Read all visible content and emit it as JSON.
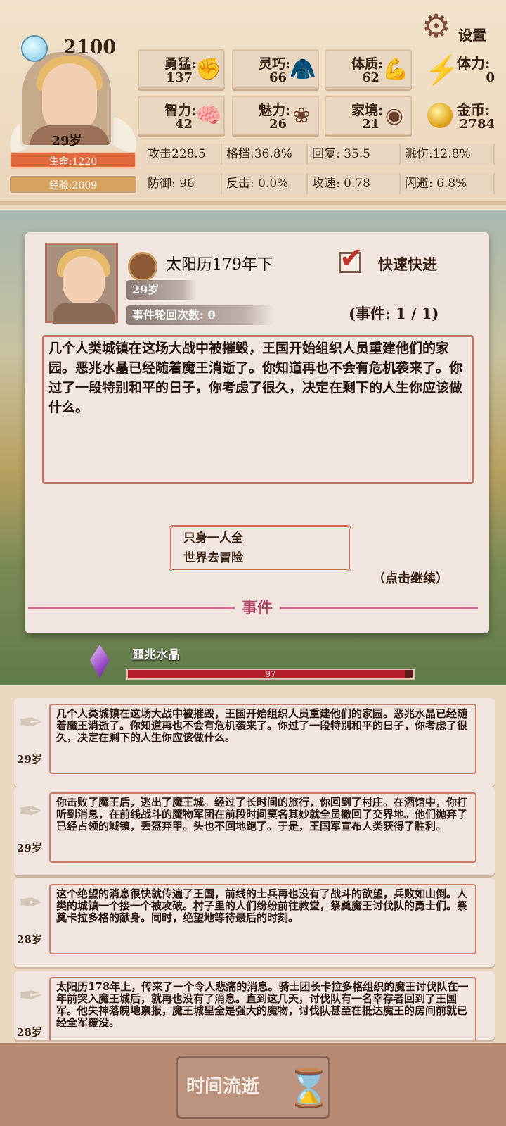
{
  "player": {
    "score": "2100",
    "age": "29岁",
    "life": "生命:1220",
    "exp": "经验:2009"
  },
  "settings_label": "设置",
  "stats": [
    {
      "label": "勇猛:",
      "value": "137",
      "icon": "fist-icon",
      "glyph": "✊"
    },
    {
      "label": "灵巧:",
      "value": "66",
      "icon": "cloak-icon",
      "glyph": "🧥"
    },
    {
      "label": "体质:",
      "value": "62",
      "icon": "arm-icon",
      "glyph": "💪"
    },
    {
      "label": "智力:",
      "value": "42",
      "icon": "brain-icon",
      "glyph": "🧠"
    },
    {
      "label": "魅力:",
      "value": "26",
      "icon": "lotus-icon",
      "glyph": "❀"
    },
    {
      "label": "家境:",
      "value": "21",
      "icon": "coinbag-icon",
      "glyph": "◉"
    }
  ],
  "stamina": {
    "label": "体力:",
    "value": "0"
  },
  "gold": {
    "label": "金币:",
    "value": "2784"
  },
  "battle": [
    [
      "攻击228.5",
      "格挡:36.8%",
      "回复:  35.5",
      "溅伤:12.8%"
    ],
    [
      "防御:    96",
      "反击:  0.0%",
      "攻速:  0.78",
      "闪避:  6.8%"
    ]
  ],
  "event": {
    "date": "太阳历179年下",
    "age": "29岁",
    "cycle": "事件轮回次数: 0",
    "fast_forward": "快速快进",
    "count": "(事件: 1 / 1)",
    "text": "几个人类城镇在这场大战中被摧毁，王国开始组织人员重建他们的家园。恶兆水晶已经随着魔王消逝了。你知道再也不会有危机袭来了。你过了一段特别和平的日子，你考虑了很久，决定在剩下的人生你应该做什么。",
    "choice_line1": "只身一人全",
    "choice_line2": "世界去冒险",
    "continue": "（点击继续）",
    "section": "事件"
  },
  "crystal": {
    "label": "噩兆水晶",
    "value": "97",
    "fraction": 0.97
  },
  "history": [
    {
      "age": "29岁",
      "text": "几个人类城镇在这场大战中被摧毁，王国开始组织人员重建他们的家园。恶兆水晶已经随着魔王消逝了。你知道再也不会有危机袭来了。你过了一段特别和平的日子，你考虑了很久，决定在剩下的人生你应该做什么。"
    },
    {
      "age": "29岁",
      "text": "你击败了魔王后，逃出了魔王城。经过了长时间的旅行，你回到了村庄。在酒馆中，你打听到消息，在前线战斗的魔物军团在前段时间莫名其妙就全员撤回了交界地。他们抛弃了已经占领的城镇，丢盔弃甲。头也不回地跑了。于是，王国军宣布人类获得了胜利。"
    },
    {
      "age": "28岁",
      "text": "这个绝望的消息很快就传遍了王国，前线的士兵再也没有了战斗的欲望，兵败如山倒。人类的城镇一个接一个被攻破。村子里的人们纷纷前往教堂，祭奠魔王讨伐队的勇士们。祭奠卡拉多格的献身。同时，绝望地等待最后的时刻。"
    },
    {
      "age": "28岁",
      "text": "太阳历178年上，传来了一个令人悲痛的消息。骑士团长卡拉多格组织的魔王讨伐队在一年前突入魔王城后，就再也没有了消息。直到这几天，讨伐队有一名幸存者回到了王国军。他失神落魄地禀报，魔王城里全是强大的魔物，讨伐队甚至在抵达魔王的房间前就已经全军覆没。"
    }
  ],
  "footer": {
    "time_label": "时间流逝"
  }
}
